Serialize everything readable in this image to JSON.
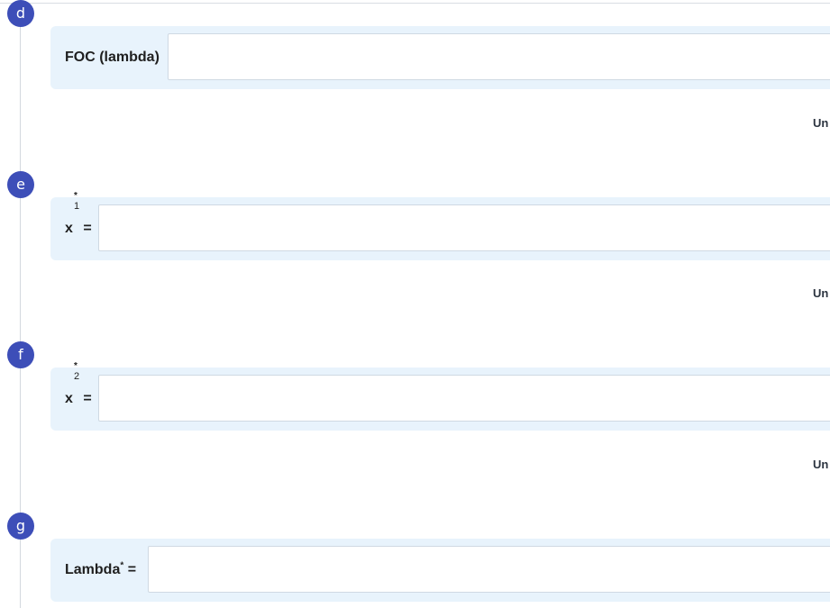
{
  "sections": [
    {
      "badge": "d",
      "label": "FOC (lambda)",
      "input_value": "",
      "status": "Un"
    },
    {
      "badge": "e",
      "label_var": "x",
      "label_sup": "*",
      "label_sub": "1",
      "label_eq": "=",
      "input_value": "",
      "status": "Un"
    },
    {
      "badge": "f",
      "label_var": "x",
      "label_sup": "*",
      "label_sub": "2",
      "label_eq": "=",
      "input_value": "",
      "status": "Un"
    },
    {
      "badge": "g",
      "label_main": "Lambda",
      "label_sup": "*",
      "label_eq": "=",
      "input_value": ""
    }
  ],
  "colors": {
    "badge": "#3d4eb8",
    "answer_box_bg": "#e8f3fc",
    "input_border": "#cfd9e3"
  }
}
